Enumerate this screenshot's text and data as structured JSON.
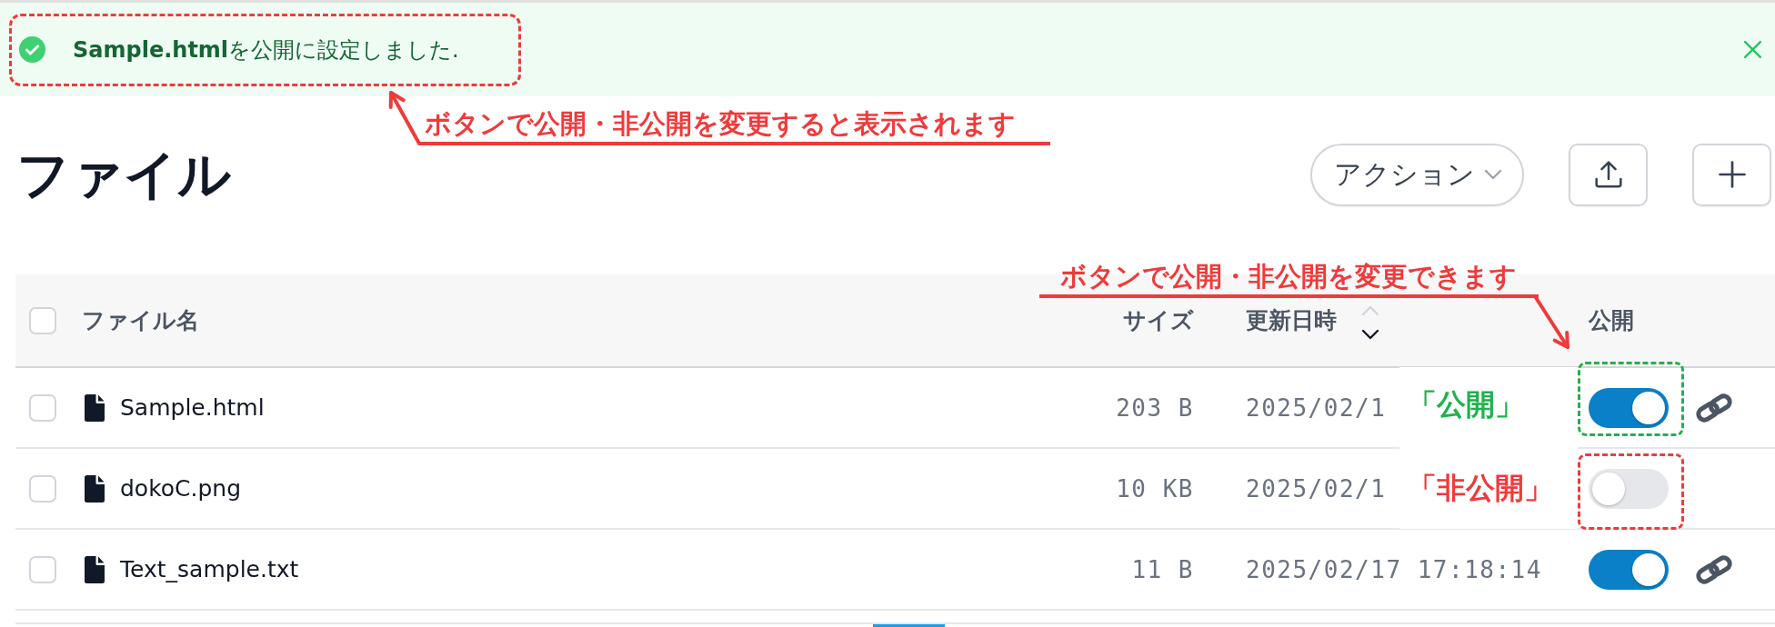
{
  "notification": {
    "success": true,
    "message": "**Sample.html**を公開に設定しました."
  },
  "header": {
    "title": "ファイル",
    "buttons": [
      {
        "kind": "dropdown",
        "label": "アクション"
      },
      {
        "kind": "upload"
      },
      {
        "kind": "add"
      }
    ]
  },
  "table": {
    "select_all": {
      "checked": false
    },
    "columns": [
      {
        "label": "ファイル名"
      },
      {
        "label": "サイズ"
      },
      {
        "label": "更新日時",
        "sort_descending": true
      },
      {
        "label": "公開"
      }
    ],
    "rows": [
      {
        "checked": false,
        "name": "Sample.html",
        "size": "203 B",
        "modified": "2025/02/1",
        "public": true
      },
      {
        "checked": false,
        "name": "dokoC.png",
        "size": "10 KB",
        "modified": "2025/02/1",
        "public": false
      },
      {
        "checked": false,
        "name": "Text_sample.txt",
        "size": "11 B",
        "modified": "2025/02/17 17:18:14",
        "public": true
      }
    ]
  },
  "annotations": {
    "callouts": [
      {
        "text": "ボタンで公開・非公開を変更すると表示されます"
      },
      {
        "text": "ボタンで公開・非公開を変更できます"
      }
    ],
    "state_labels": [
      {
        "text": "「公開」",
        "color": "#1fb24e"
      },
      {
        "text": "「非公開」",
        "color": "#f03a3a"
      }
    ]
  }
}
